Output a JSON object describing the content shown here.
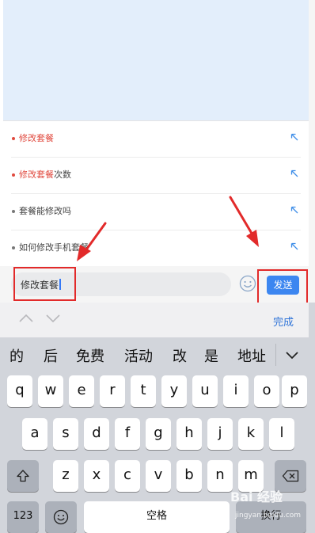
{
  "suggestions": [
    {
      "highlight": "修改套餐",
      "rest": ""
    },
    {
      "highlight": "修改套餐",
      "rest": "次数"
    },
    {
      "highlight": "",
      "rest": "套餐能修改吗"
    },
    {
      "highlight": "",
      "rest": "如何修改手机套餐"
    }
  ],
  "input": {
    "value": "修改套餐"
  },
  "send_label": "发送",
  "accessory": {
    "done_label": "完成"
  },
  "candidates": [
    "的",
    "后",
    "免费",
    "活动",
    "改",
    "是",
    "地址"
  ],
  "keys": {
    "row1": [
      "q",
      "w",
      "e",
      "r",
      "t",
      "y",
      "u",
      "i",
      "o",
      "p"
    ],
    "row2": [
      "a",
      "s",
      "d",
      "f",
      "g",
      "h",
      "j",
      "k",
      "l"
    ],
    "row3": [
      "z",
      "x",
      "c",
      "v",
      "b",
      "n",
      "m"
    ],
    "numbers_label": "123",
    "space_label": "空格",
    "return_label": "换行"
  },
  "watermark": {
    "text": "Bai 经验",
    "sub": "jingyan.baidu.com"
  },
  "colors": {
    "highlight": "#e0493e",
    "send": "#3c86f0",
    "annotation": "#e22a2a",
    "done": "#2f74d8"
  }
}
